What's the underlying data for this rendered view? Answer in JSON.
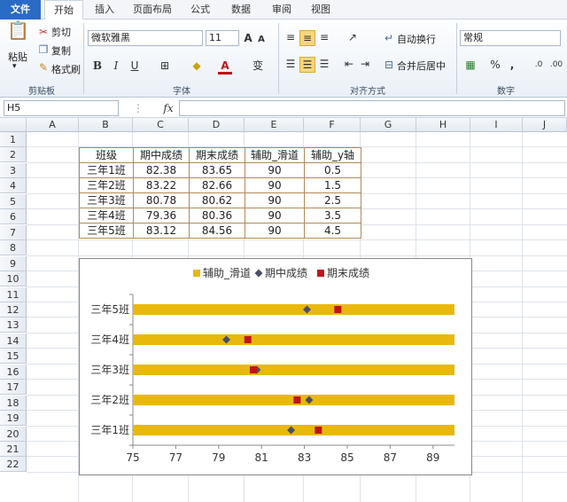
{
  "ribbon_tabs": [
    "文件",
    "开始",
    "插入",
    "页面布局",
    "公式",
    "数据",
    "审阅",
    "视图"
  ],
  "clipboard": {
    "paste": "粘贴",
    "cut": "剪切",
    "copy": "复制",
    "format_painter": "格式刷",
    "label": "剪贴板"
  },
  "font": {
    "name": "微软雅黑",
    "size": "11",
    "label": "字体",
    "bold": "B",
    "italic": "I",
    "underline": "U",
    "grow": "A",
    "shrink": "A",
    "phonetic": "变"
  },
  "alignment": {
    "wrap": "自动换行",
    "merge": "合并后居中",
    "label": "对齐方式"
  },
  "number": {
    "format": "常规",
    "percent": "%",
    "comma": ",",
    "label": "数字",
    "inc_decimal": ".00",
    "dec_decimal": ".0"
  },
  "formula_bar": {
    "cell_ref": "H5",
    "fx": "fx",
    "value": ""
  },
  "columns": [
    "A",
    "B",
    "C",
    "D",
    "E",
    "F",
    "G",
    "H",
    "I",
    "J"
  ],
  "rows": [
    "1",
    "2",
    "3",
    "4",
    "5",
    "6",
    "7",
    "8",
    "9",
    "10",
    "11",
    "12",
    "13",
    "14",
    "15",
    "16",
    "17",
    "18",
    "19",
    "20",
    "21",
    "22"
  ],
  "table": {
    "headers": [
      "班级",
      "期中成绩",
      "期末成绩",
      "辅助_滑道",
      "辅助_y轴"
    ],
    "rows": [
      [
        "三年1班",
        "82.38",
        "83.65",
        "90",
        "0.5"
      ],
      [
        "三年2班",
        "83.22",
        "82.66",
        "90",
        "1.5"
      ],
      [
        "三年3班",
        "80.78",
        "80.62",
        "90",
        "2.5"
      ],
      [
        "三年4班",
        "79.36",
        "80.36",
        "90",
        "3.5"
      ],
      [
        "三年5班",
        "83.12",
        "84.56",
        "90",
        "4.5"
      ]
    ]
  },
  "chart_data": {
    "type": "scatter",
    "legend": [
      "辅助_滑道",
      "期中成绩",
      "期末成绩"
    ],
    "legend_position": "top",
    "categories": [
      "三年1班",
      "三年2班",
      "三年3班",
      "三年4班",
      "三年5班"
    ],
    "y": [
      0.5,
      1.5,
      2.5,
      3.5,
      4.5
    ],
    "series": [
      {
        "name": "辅助_滑道",
        "values": [
          90,
          90,
          90,
          90,
          90
        ],
        "color": "#e8b90c"
      },
      {
        "name": "期中成绩",
        "values": [
          82.38,
          83.22,
          80.78,
          79.36,
          83.12
        ],
        "color": "#4a4f66"
      },
      {
        "name": "期末成绩",
        "values": [
          83.65,
          82.66,
          80.62,
          80.36,
          84.56
        ],
        "color": "#c0141a"
      }
    ],
    "xlim": [
      75,
      90
    ],
    "xticks": [
      "75",
      "77",
      "79",
      "81",
      "83",
      "85",
      "87",
      "89"
    ],
    "grid": false
  }
}
